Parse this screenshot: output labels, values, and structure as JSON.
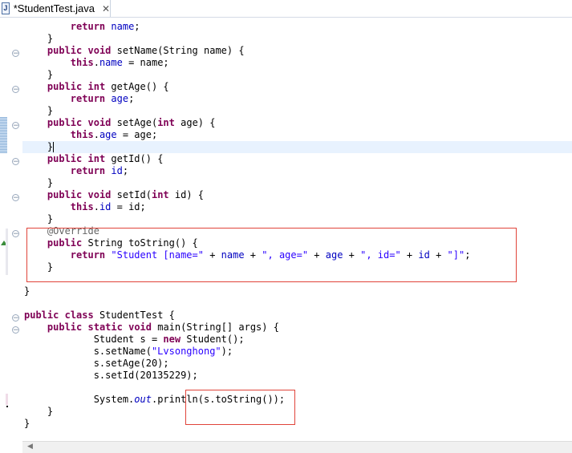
{
  "tab": {
    "title": "*StudentTest.java",
    "icon": "java-file-icon",
    "close": "✕"
  },
  "colors": {
    "keyword": "#7f0055",
    "field": "#0000c0",
    "string": "#2a00ff",
    "annotation": "#646464",
    "highlight_box": "#e0443a",
    "current_line": "#e8f2fe"
  },
  "code": {
    "l1": {
      "kw": "return",
      "fld": "name",
      "end": ";"
    },
    "l2": {
      "t": "}"
    },
    "l3": {
      "kw1": "public",
      "kw2": "void",
      "t": " setName(String name) {"
    },
    "l4": {
      "kw": "this",
      "dot": ".",
      "fld": "name",
      "t": " = name;"
    },
    "l5": {
      "t": "}"
    },
    "l6": {
      "kw1": "public",
      "kw2": "int",
      "t": " getAge() {"
    },
    "l7": {
      "kw": "return",
      "fld": "age",
      "end": ";"
    },
    "l8": {
      "t": "}"
    },
    "l9": {
      "kw1": "public",
      "kw2": "void",
      "t": " setAge(",
      "kw3": "int",
      "t2": " age) {"
    },
    "l10": {
      "kw": "this",
      "dot": ".",
      "fld": "age",
      "t": " = age;"
    },
    "l11": {
      "t": "}"
    },
    "l12": {
      "kw1": "public",
      "kw2": "int",
      "t": " getId() {"
    },
    "l13": {
      "kw": "return",
      "fld": "id",
      "end": ";"
    },
    "l14": {
      "t": "}"
    },
    "l15": {
      "kw1": "public",
      "kw2": "void",
      "t": " setId(",
      "kw3": "int",
      "t2": " id) {"
    },
    "l16": {
      "kw": "this",
      "dot": ".",
      "fld": "id",
      "t": " = id;"
    },
    "l17": {
      "t": "}"
    },
    "l18": {
      "ann": "@Override"
    },
    "l19": {
      "kw": "public",
      "t": " String toString() {"
    },
    "l20": {
      "kw": "return",
      "s1": "\"Student [name=\"",
      "p1": " + ",
      "f1": "name",
      "p2": " + ",
      "s2": "\", age=\"",
      "p3": " + ",
      "f2": "age",
      "p4": " + ",
      "s3": "\", id=\"",
      "p5": " + ",
      "f3": "id",
      "p6": " + ",
      "s4": "\"]\"",
      "end": ";"
    },
    "l21": {
      "t": "}"
    },
    "l23": {
      "t": "}"
    },
    "l25": {
      "kw1": "public",
      "kw2": "class",
      "t": " StudentTest {"
    },
    "l26": {
      "kw1": "public",
      "kw2": "static",
      "kw3": "void",
      "t": " main(String[] args) {"
    },
    "l27": {
      "t": "Student s = ",
      "kw": "new",
      "t2": " Student();"
    },
    "l28": {
      "t": "s.setName(",
      "s": "\"Lvsonghong\"",
      "t2": ");"
    },
    "l29": {
      "t": "s.setAge(20);"
    },
    "l30": {
      "t": "s.setId(20135229);"
    },
    "l32": {
      "t": "System.",
      "it": "out",
      "t2": ".println(s.toString());"
    },
    "l33": {
      "t": "}"
    },
    "l34": {
      "t": "}"
    }
  }
}
